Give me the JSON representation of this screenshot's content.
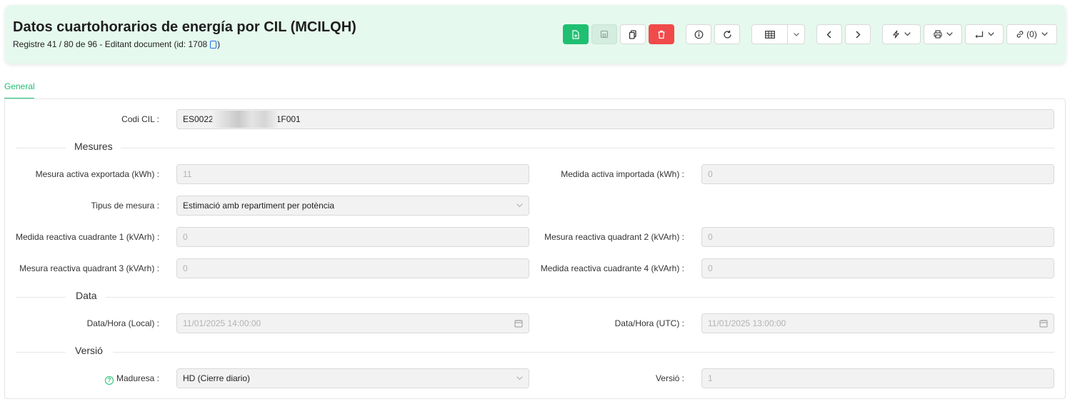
{
  "header": {
    "title": "Datos cuartohorarios de energía por CIL (MCILQH)",
    "subtitle": "Registre 41 / 80 de 96 - Editant document (id: 1708",
    "subtitle_end": ")"
  },
  "toolbar": {
    "links_label": "(0)"
  },
  "tabs": [
    {
      "label": "General",
      "active": true
    }
  ],
  "form": {
    "cil": {
      "label": "Codi CIL :",
      "value_prefix": "ES0022",
      "value_suffix": "1F001"
    },
    "section_mesures": "Mesures",
    "activa_exportada": {
      "label": "Mesura activa exportada (kWh) :",
      "value": "11"
    },
    "activa_importada": {
      "label": "Medida activa importada (kWh) :",
      "value": "0"
    },
    "tipus_mesura": {
      "label": "Tipus de mesura :",
      "value": "Estimació amb repartiment per potència"
    },
    "reactiva_q1": {
      "label": "Medida reactiva cuadrante 1 (kVArh) :",
      "value": "0"
    },
    "reactiva_q2": {
      "label": "Mesura reactiva quadrant 2 (kVArh) :",
      "value": "0"
    },
    "reactiva_q3": {
      "label": "Mesura reactiva quadrant 3 (kVArh) :",
      "value": "0"
    },
    "reactiva_q4": {
      "label": "Medida reactiva cuadrante 4 (kVArh) :",
      "value": "0"
    },
    "section_data": "Data",
    "data_local": {
      "label": "Data/Hora (Local) :",
      "value": "11/01/2025 14:00:00"
    },
    "data_utc": {
      "label": "Data/Hora (UTC) :",
      "value": "11/01/2025 13:00:00"
    },
    "section_versio": "Versió",
    "maduresa": {
      "label": "Maduresa :",
      "value": "HD (Cierre diario)"
    },
    "versio": {
      "label": "Versió :",
      "value": "1"
    }
  },
  "colors": {
    "accent": "#1fbf72",
    "danger": "#f04a4a",
    "header_bg": "#e6f9ee"
  }
}
